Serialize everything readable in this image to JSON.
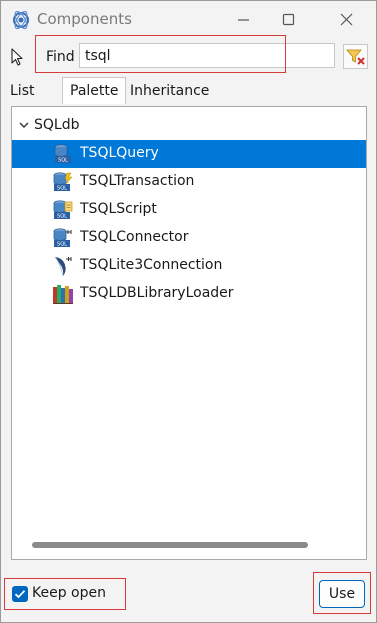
{
  "window": {
    "title": "Components",
    "app_icon": "gear-atom-icon"
  },
  "controls": {
    "minimize": "minimize-icon",
    "maximize": "maximize-icon",
    "close": "close-icon"
  },
  "search": {
    "label": "Find",
    "value": "tsql",
    "filter_icon": "filter-clear-icon"
  },
  "tabs": [
    {
      "label": "List",
      "active": false
    },
    {
      "label": "Palette",
      "active": true
    },
    {
      "label": "Inheritance",
      "active": false
    }
  ],
  "tree": {
    "root": {
      "label": "SQLdb",
      "expanded": true
    },
    "items": [
      {
        "label": "TSQLQuery",
        "icon": "sql-database-icon",
        "selected": true
      },
      {
        "label": "TSQLTransaction",
        "icon": "sql-transaction-icon",
        "selected": false
      },
      {
        "label": "TSQLScript",
        "icon": "sql-script-icon",
        "selected": false
      },
      {
        "label": "TSQLConnector",
        "icon": "sql-connector-icon",
        "selected": false
      },
      {
        "label": "TSQLite3Connection",
        "icon": "sqlite-feather-icon",
        "selected": false
      },
      {
        "label": "TSQLDBLibraryLoader",
        "icon": "library-books-icon",
        "selected": false
      }
    ]
  },
  "footer": {
    "keep_open_label": "Keep open",
    "keep_open_checked": true,
    "use_label": "Use"
  },
  "colors": {
    "selection": "#0078d7",
    "accent": "#0067c0",
    "highlight_box": "#d83a3a"
  }
}
